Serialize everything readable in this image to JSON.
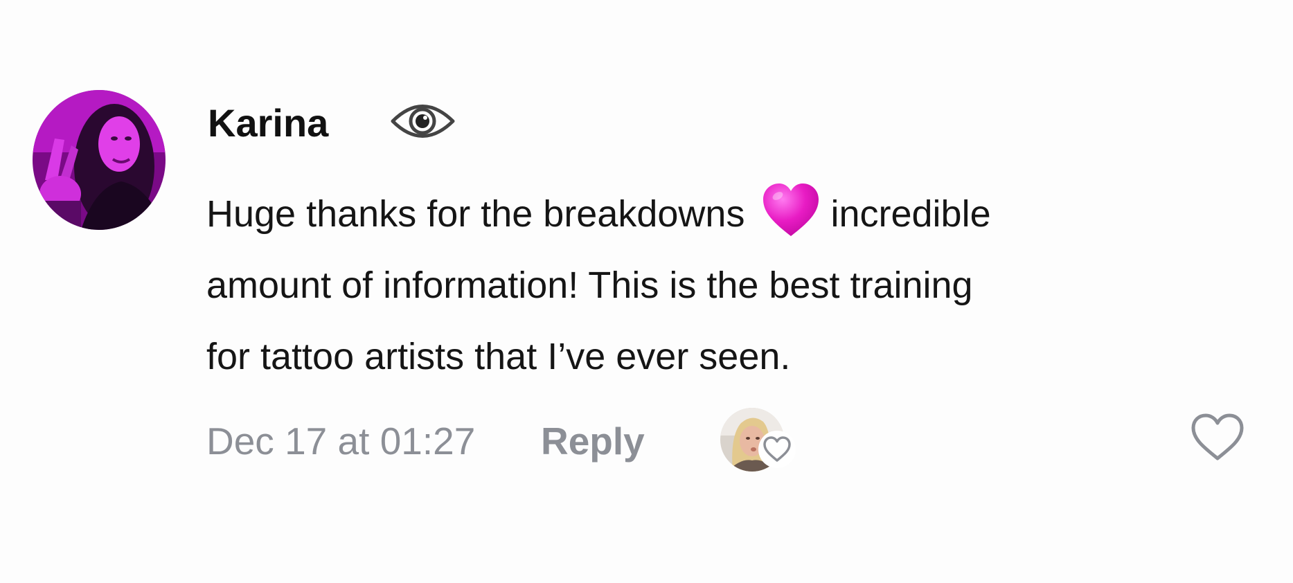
{
  "comment": {
    "username": "Karina",
    "username_badge_icon": "eye-icon",
    "text_lines": [
      "Huge thanks for the breakdowns",
      "incredible",
      "amount of information! This is the best training",
      "for tattoo artists that I’ve ever seen."
    ],
    "inline_emoji": "pink-heart",
    "timestamp": "Dec 17 at 01:27",
    "reply_label": "Reply",
    "liked_by_creator_icon": "heart-outline-icon",
    "like_icon": "heart-outline-icon"
  },
  "colors": {
    "text_primary": "#111111",
    "text_secondary": "#8c8f96",
    "emoji_heart": "#e81cc4",
    "icon_gray": "#8c8f96",
    "eye_icon": "#444444"
  }
}
